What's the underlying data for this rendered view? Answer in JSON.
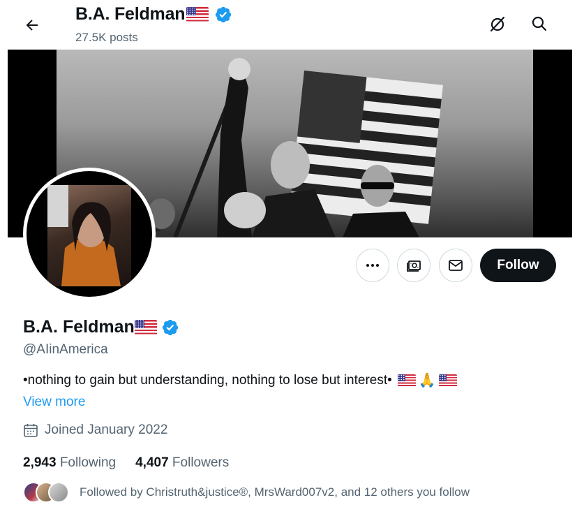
{
  "header": {
    "name": "B.A. Feldman",
    "posts_count": "27.5K posts"
  },
  "profile": {
    "name": "B.A. Feldman",
    "handle": "@AIinAmerica",
    "bio": "•nothing to gain but understanding, nothing to lose but interest•",
    "bio_emojis": [
      "us-flag",
      "folded-hands",
      "us-flag"
    ],
    "pray_emoji": "🙏",
    "view_more": "View more",
    "joined": "Joined January 2022",
    "verified": true
  },
  "actions": {
    "follow_label": "Follow"
  },
  "stats": {
    "following_count": "2,943",
    "following_label": "Following",
    "followers_count": "4,407",
    "followers_label": "Followers"
  },
  "followed_by": {
    "text": "Followed by Christruth&justice®, MrsWard007v2, and 12 others you follow"
  },
  "icons": [
    "back-arrow-icon",
    "grok-icon",
    "search-icon",
    "more-icon",
    "subscribe-icon",
    "message-icon",
    "calendar-icon",
    "verified-badge-icon"
  ],
  "colors": {
    "accent": "#1d9bf0",
    "text": "#0f1419",
    "secondary_text": "#536471",
    "follow_button_bg": "#0f1419",
    "border": "#cfd9de"
  }
}
